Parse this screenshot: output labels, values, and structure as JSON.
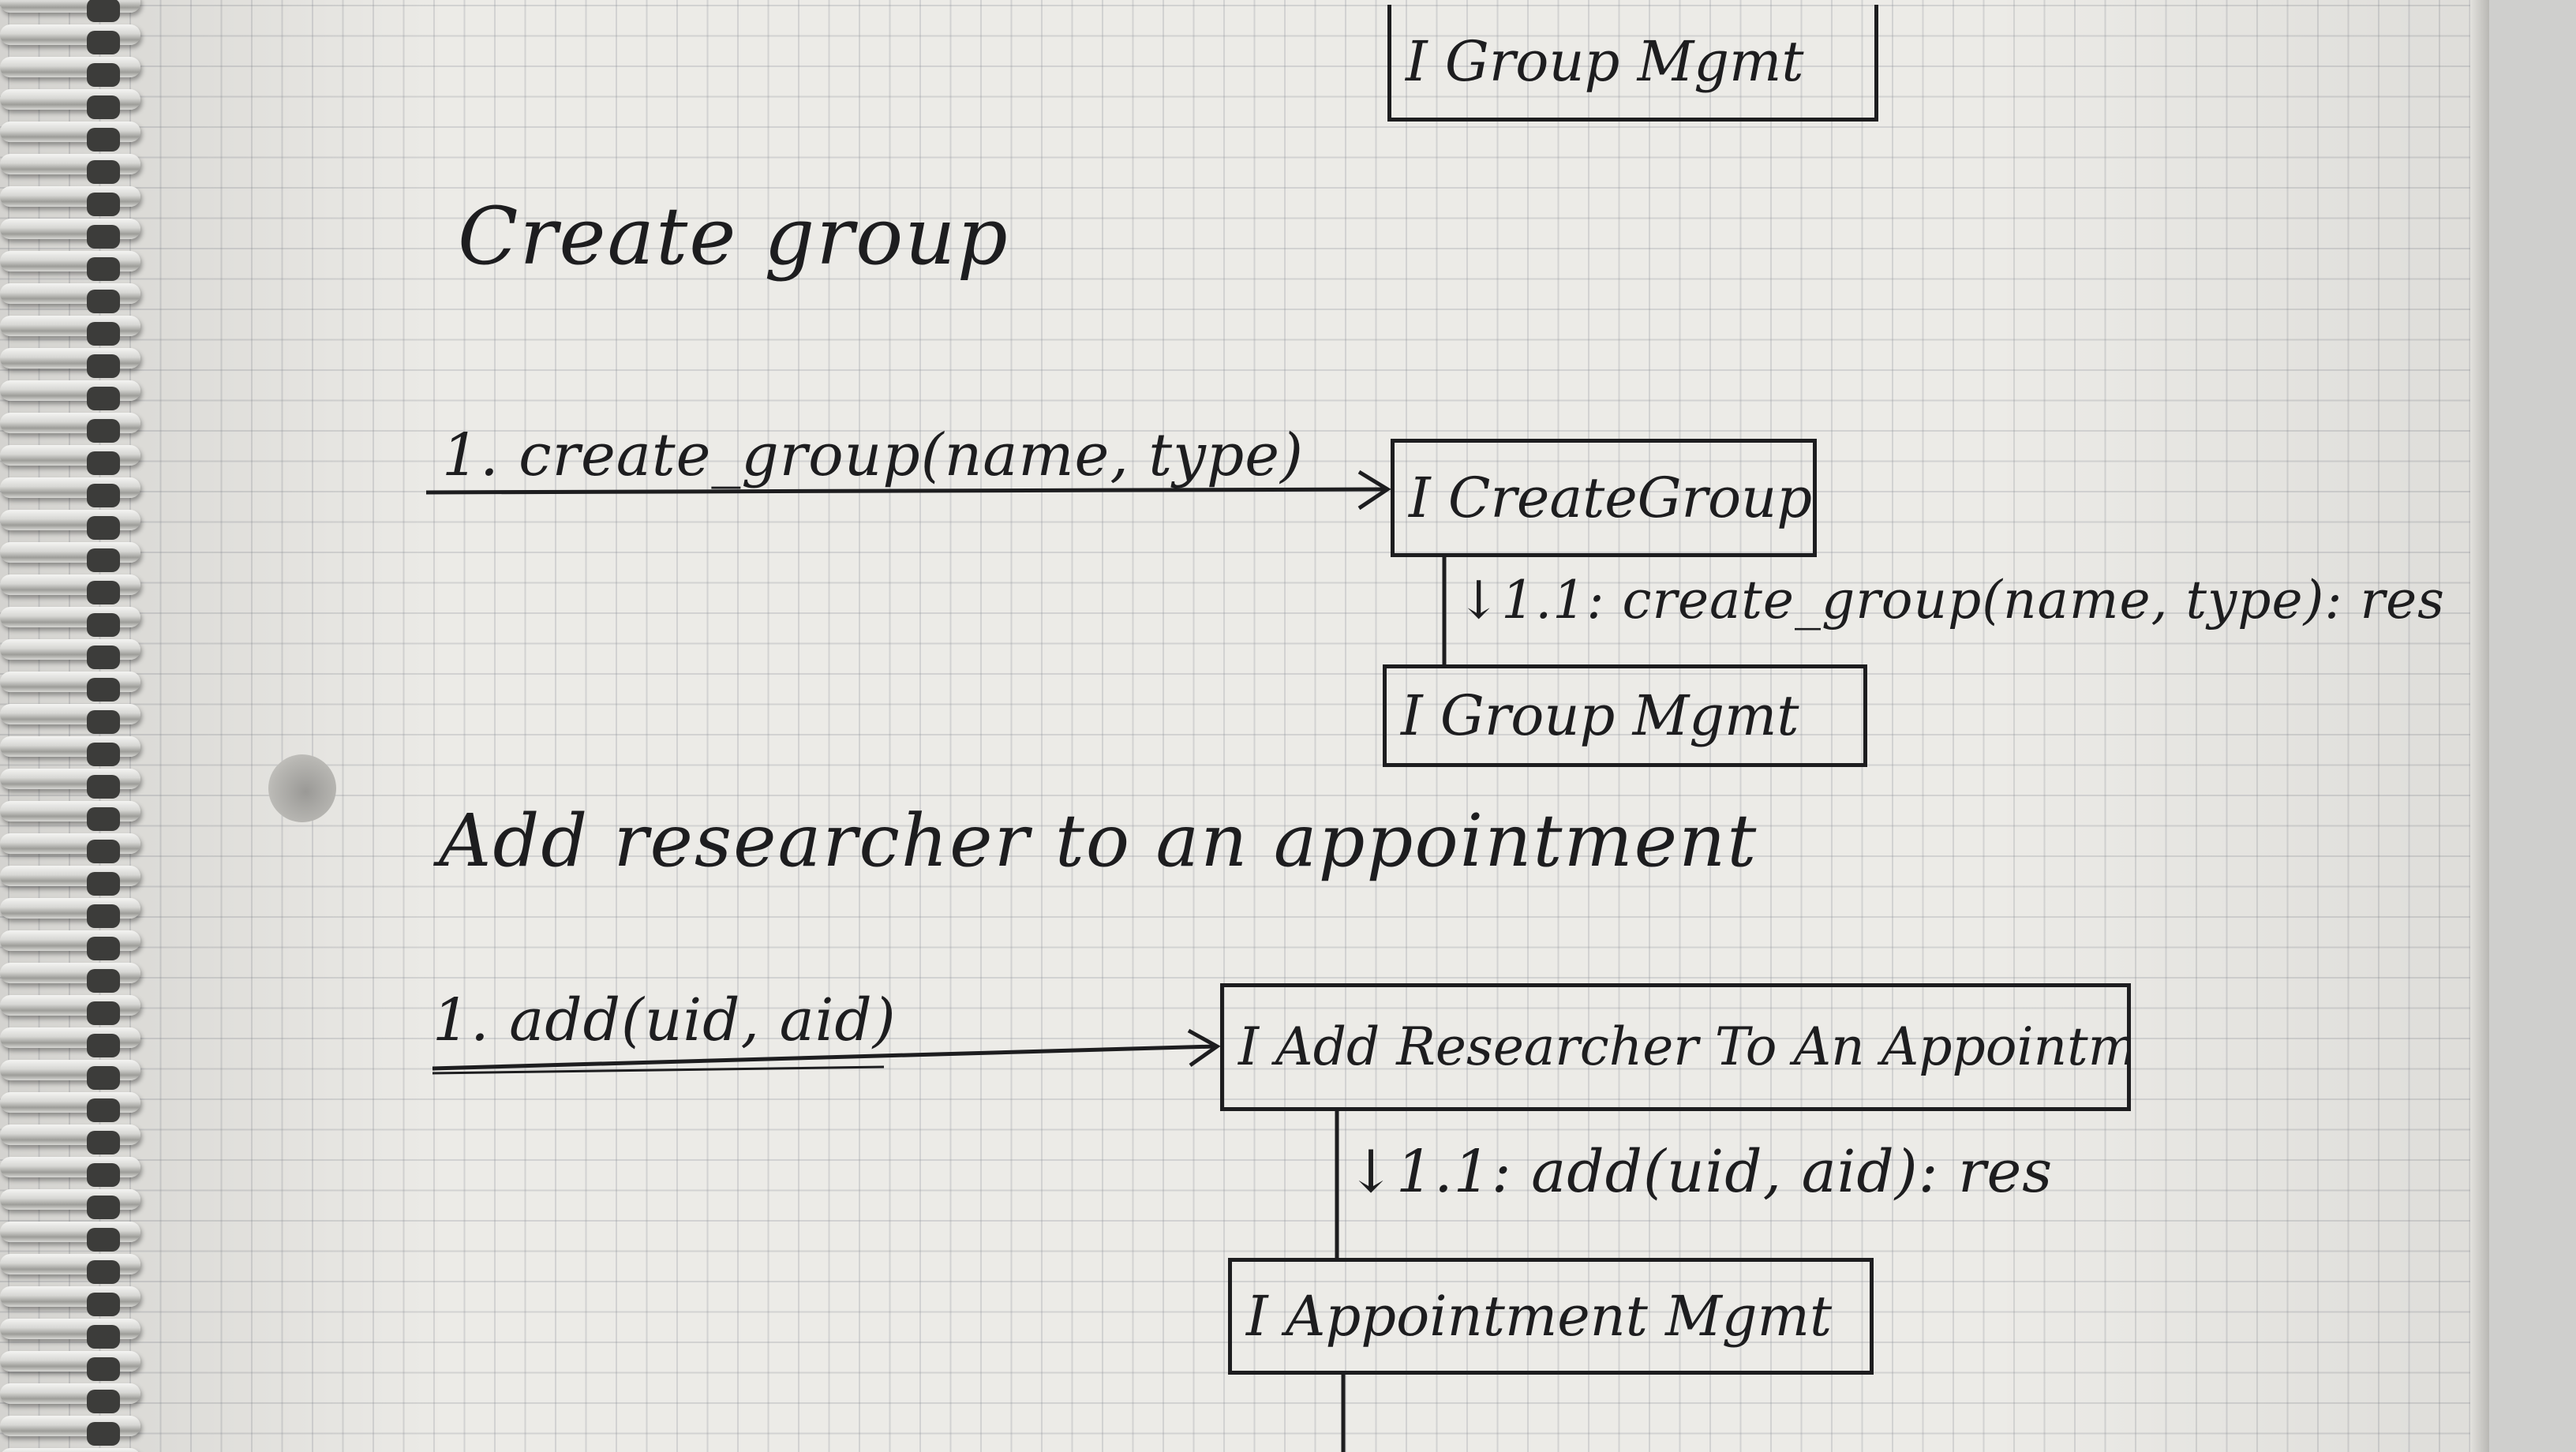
{
  "diagram": {
    "top_box": {
      "label": "I Group Mgmt"
    },
    "section_create": {
      "title": "Create group",
      "message_1": "1. create_group(name, type)",
      "component_box": "I CreateGroup",
      "message_1_1": "↓1.1: create_group(name, type): res",
      "target_box": "I Group Mgmt"
    },
    "section_add": {
      "title": "Add researcher to an appointment",
      "message_1": "1. add(uid, aid)",
      "component_box": "I Add Researcher To An Appointment",
      "message_1_1": "↓1.1: add(uid, aid): res",
      "target_box": "I Appointment Mgmt"
    }
  }
}
